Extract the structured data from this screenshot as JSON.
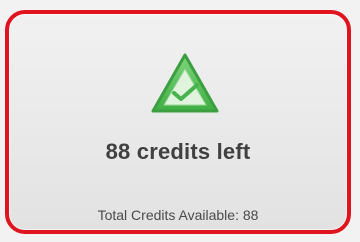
{
  "card": {
    "icon": "warning-check-triangle-icon",
    "accent_color": "#e0141e",
    "icon_color": "#58c25a",
    "headline": "88 credits left",
    "subline": "Total Credits Available: 88"
  }
}
